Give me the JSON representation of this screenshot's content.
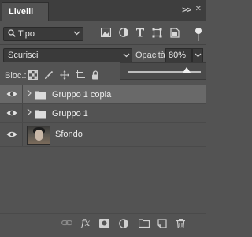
{
  "panel": {
    "tab_title": "Livelli",
    "collapse_glyph": ">>",
    "close_glyph": "✕"
  },
  "filter": {
    "kind_label": "Tipo",
    "icons": [
      "pixel-layer-filter-icon",
      "adjustment-layer-filter-icon",
      "type-layer-filter-icon",
      "shape-layer-filter-icon",
      "smart-object-filter-icon"
    ],
    "filter_enabled": true
  },
  "blend": {
    "mode": "Scurisci",
    "opacity_label": "Opacità:",
    "opacity_value": "80%",
    "opacity_slider_fraction": 0.8
  },
  "lock": {
    "label": "Bloc.:",
    "icons": [
      "lock-transparent-pixels-icon",
      "lock-image-pixels-icon",
      "lock-position-icon",
      "lock-artboard-icon",
      "lock-all-icon"
    ]
  },
  "layers": [
    {
      "name": "Gruppo 1 copia",
      "type": "group",
      "visible": true,
      "selected": true
    },
    {
      "name": "Gruppo 1",
      "type": "group",
      "visible": true,
      "selected": false
    },
    {
      "name": "Sfondo",
      "type": "image",
      "visible": true,
      "selected": false
    }
  ],
  "bottom_toolbar": {
    "icons": [
      "link-layers-icon",
      "fx-icon",
      "add-mask-icon",
      "adjustment-layer-icon",
      "new-group-icon",
      "new-layer-icon",
      "delete-layer-icon"
    ],
    "fx_label": "fx"
  },
  "colors": {
    "panel_bg": "#535353",
    "header_bg": "#3e3e3e",
    "selected_row": "#696969",
    "text": "#e6e6e6"
  }
}
